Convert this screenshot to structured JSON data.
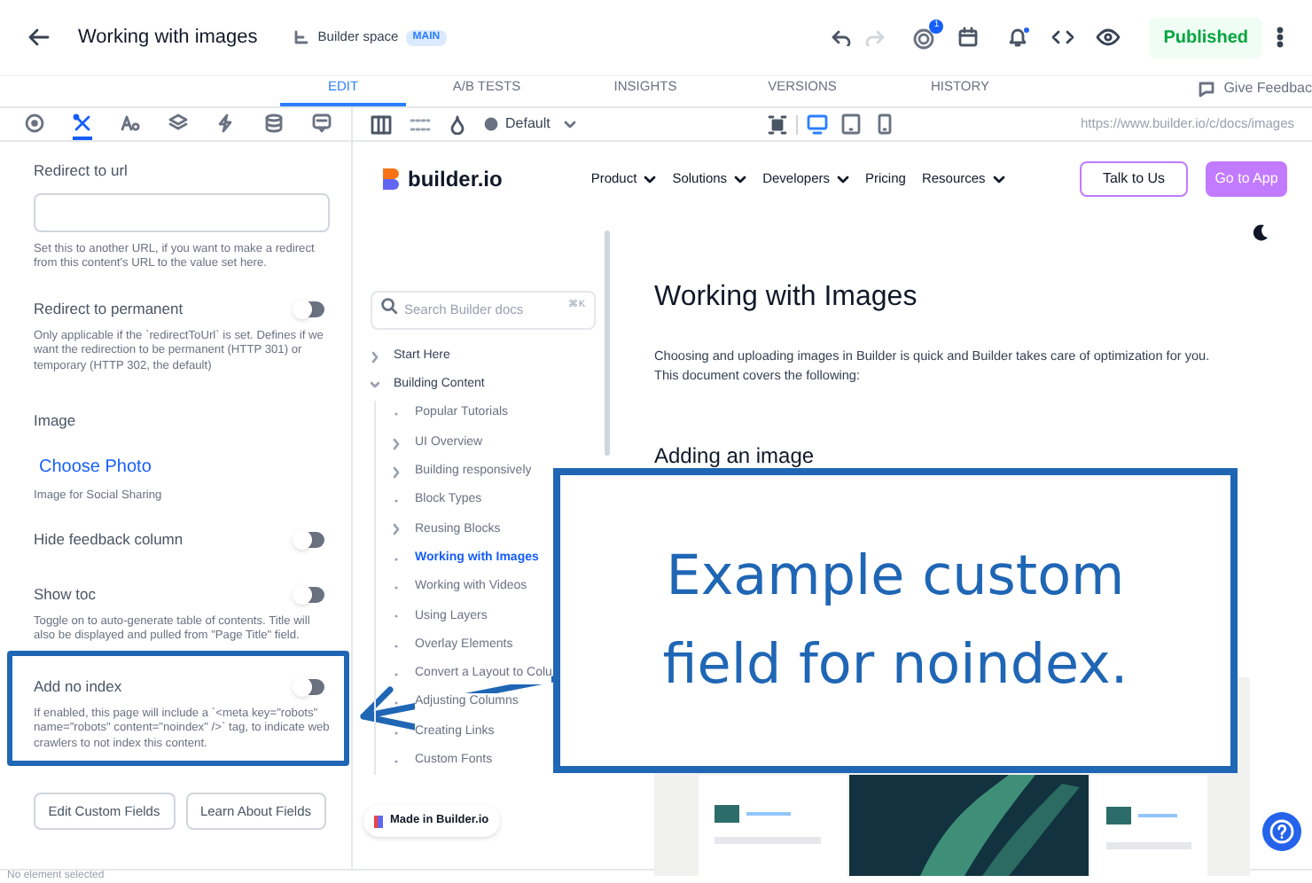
{
  "header": {
    "title": "Working with images",
    "space": "Builder space",
    "branch": "MAIN",
    "notifications": "1",
    "status": "Published"
  },
  "tabs": [
    {
      "label": "EDIT",
      "selected": true
    },
    {
      "label": "A/B TESTS",
      "selected": false
    },
    {
      "label": "INSIGHTS",
      "selected": false
    },
    {
      "label": "VERSIONS",
      "selected": false
    },
    {
      "label": "HISTORY",
      "selected": false
    }
  ],
  "feedback": "Give Feedbac",
  "panel_tabs": [
    {
      "selected": false
    },
    {
      "selected": true
    },
    {
      "selected": false
    },
    {
      "selected": false
    },
    {
      "selected": false
    },
    {
      "selected": false
    },
    {
      "selected": false
    }
  ],
  "toolbar": {
    "breakpoint": "Default",
    "devices": [
      {
        "selected": true
      },
      {
        "selected": false
      },
      {
        "selected": false
      }
    ],
    "url": "https://www.builder.io/c/docs/images"
  },
  "fields": [
    {
      "kind": "text",
      "label": "Redirect to url",
      "help": "Set this to another URL, if you want to make a redirect from this content's URL to the value set here.",
      "highlighted": false
    },
    {
      "kind": "toggle",
      "label": "Redirect to permanent",
      "on": false,
      "help": "Only applicable if the `redirectToUrl` is set. Defines if we want the redirection to be permanent (HTTP 301) or temporary (HTTP 302, the default)",
      "highlighted": false
    },
    {
      "label": "Image",
      "action": "Choose Photo",
      "help": "Image for Social Sharing",
      "highlighted": false
    },
    {
      "kind": "toggle",
      "label": "Hide feedback column",
      "on": false,
      "highlighted": false
    },
    {
      "kind": "toggle",
      "label": "Show toc",
      "on": false,
      "help": "Toggle on to auto-generate table of contents. Title will also be displayed and pulled from \"Page Title\" field.",
      "highlighted": false
    },
    {
      "kind": "toggle",
      "label": "Add no index",
      "on": false,
      "help": "If enabled, this page will include a `<meta key=\"robots\" name=\"robots\" content=\"noindex\" />` tag, to indicate web crawlers to not index this content.",
      "highlighted": true
    }
  ],
  "panel_buttons": [
    "Edit Custom Fields",
    "Learn About Fields"
  ],
  "site": {
    "logo": "builder.io",
    "nav": [
      {
        "label": "Product",
        "dropdown": true
      },
      {
        "label": "Solutions",
        "dropdown": true
      },
      {
        "label": "Developers",
        "dropdown": true
      },
      {
        "label": "Pricing",
        "dropdown": false
      },
      {
        "label": "Resources",
        "dropdown": true
      }
    ],
    "buttons": [
      "Talk to Us",
      "Go to App"
    ],
    "search_placeholder": "Search Builder docs",
    "shortcut": "⌘K",
    "docs_nav": [
      {
        "label": "Start Here",
        "kind": "section",
        "expanded": false
      },
      {
        "label": "Building Content",
        "kind": "section",
        "expanded": true,
        "children": [
          {
            "label": "Popular Tutorials",
            "kind": "page",
            "selected": false
          },
          {
            "label": "UI Overview",
            "kind": "section",
            "selected": false
          },
          {
            "label": "Building responsively",
            "kind": "section",
            "selected": false
          },
          {
            "label": "Block Types",
            "kind": "page",
            "selected": false
          },
          {
            "label": "Reusing Blocks",
            "kind": "section",
            "selected": false
          },
          {
            "label": "Working with Images",
            "kind": "page",
            "selected": true
          },
          {
            "label": "Working with Videos",
            "kind": "page",
            "selected": false
          },
          {
            "label": "Using Layers",
            "kind": "page",
            "selected": false
          },
          {
            "label": "Overlay Elements",
            "kind": "page",
            "selected": false
          },
          {
            "label": "Convert a Layout to Colu",
            "kind": "page",
            "selected": false
          },
          {
            "label": "Adjusting Columns",
            "kind": "page",
            "selected": false
          },
          {
            "label": "Creating Links",
            "kind": "page",
            "selected": false
          },
          {
            "label": "Custom Fonts",
            "kind": "page",
            "selected": false
          }
        ]
      }
    ],
    "article": {
      "title": "Working with Images",
      "intro": "Choosing and uploading images in Builder is quick and Builder takes care of optimization for you. This document covers the following:",
      "heading": "Adding an image"
    },
    "badge": "Made in Builder.io"
  },
  "status_bar": "No element selected",
  "callout": "Example custom field for noindex."
}
